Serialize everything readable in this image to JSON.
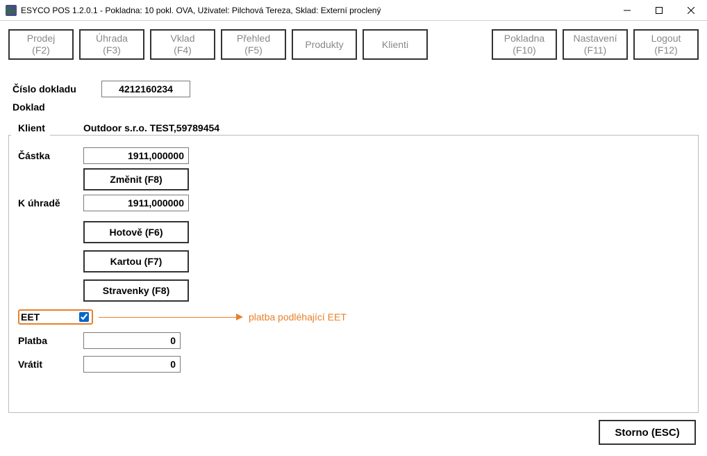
{
  "window": {
    "title": "ESYCO POS 1.2.0.1 - Pokladna: 10   pokl. OVA, Uživatel: Pilchová Tereza, Sklad: Externí proclený",
    "icon_glyph": "$»"
  },
  "toolbar": {
    "prodej": {
      "top": "Prodej",
      "bot": "(F2)"
    },
    "uhrada": {
      "top": "Úhrada",
      "bot": "(F3)"
    },
    "vklad": {
      "top": "Vklad",
      "bot": "(F4)"
    },
    "prehled": {
      "top": "Přehled",
      "bot": "(F5)"
    },
    "produkty": {
      "top": "Produkty",
      "bot": ""
    },
    "klienti": {
      "top": "Klienti",
      "bot": ""
    },
    "pokladna": {
      "top": "Pokladna",
      "bot": "(F10)"
    },
    "nastaveni": {
      "top": "Nastavení",
      "bot": "(F11)"
    },
    "logout": {
      "top": "Logout",
      "bot": "(F12)"
    }
  },
  "labels": {
    "cislo": "Číslo dokladu",
    "doklad": "Doklad",
    "klient": "Klient",
    "castka": "Částka",
    "kuhrade": "K úhradě",
    "eet": "EET",
    "platba": "Platba",
    "vratit": "Vrátit"
  },
  "buttons": {
    "zmenit": "Změnit (F8)",
    "hotove": "Hotově (F6)",
    "kartou": "Kartou (F7)",
    "stravenky": "Stravenky (F8)",
    "storno": "Storno (ESC)"
  },
  "values": {
    "cislo": "4212160234",
    "klient": "Outdoor s.r.o. TEST,59789454",
    "castka": "1911,000000",
    "kuhrade": "1911,000000",
    "platba": "0",
    "vratit": "0",
    "eet_checked": true
  },
  "annotation": "platba podléhající EET"
}
